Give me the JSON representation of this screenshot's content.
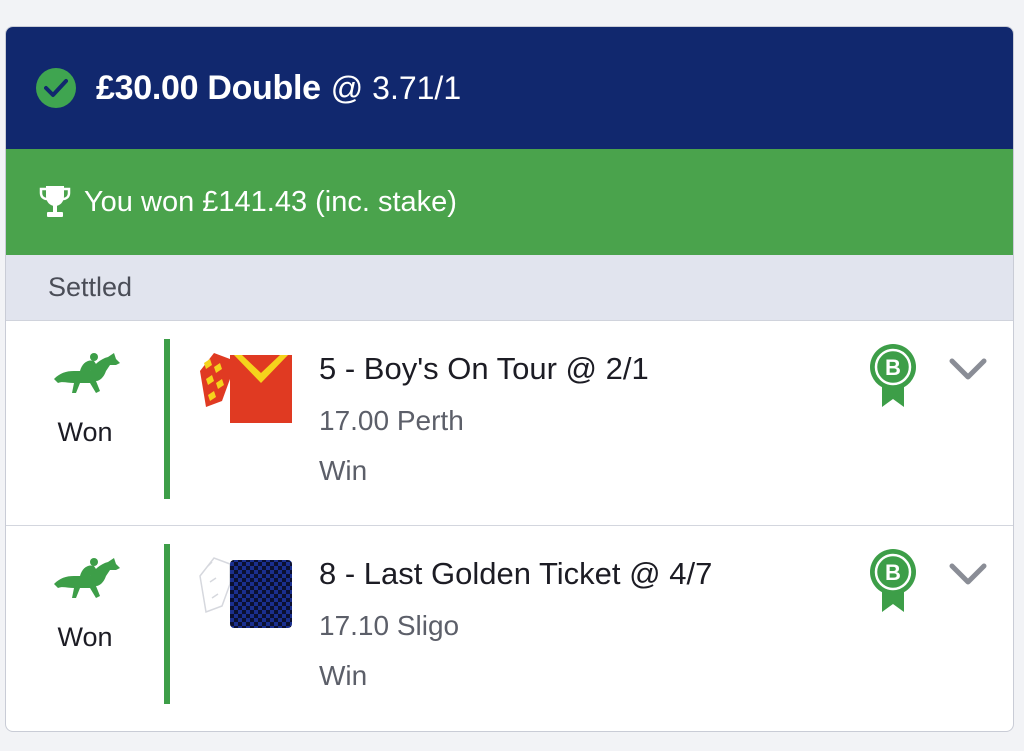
{
  "bet": {
    "stake_and_type": "£30.00 Double",
    "odds": "@ 3.71/1",
    "status_icon": "check-circle-icon"
  },
  "banner": {
    "icon": "trophy-icon",
    "text": "You won £141.43 (inc. stake)"
  },
  "status": {
    "label": "Settled"
  },
  "selections": [
    {
      "result": "Won",
      "result_icon": "horse-racing-icon",
      "name": "5 - Boy's On Tour @ 2/1",
      "time_venue": "17.00 Perth",
      "market": "Win",
      "badge": "B",
      "silks": "red-yellow-silks"
    },
    {
      "result": "Won",
      "result_icon": "horse-racing-icon",
      "name": "8 - Last Golden Ticket @ 4/7",
      "time_venue": "17.10 Sligo",
      "market": "Win",
      "badge": "B",
      "silks": "navy-check-silks"
    }
  ],
  "colors": {
    "header_bg": "#11286e",
    "banner_bg": "#4aa34c",
    "status_bg": "#e1e4ee",
    "accent_green": "#3d9e48",
    "silks_red": "#e03a22",
    "silks_yellow": "#f5d31c",
    "silks_navy": "#1a2f8f"
  }
}
